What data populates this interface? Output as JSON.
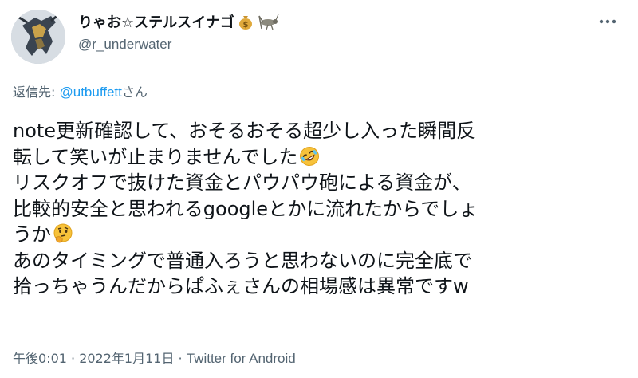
{
  "author": {
    "display_name": "りゃお☆ステルスイナゴ",
    "name_icons": [
      "money-bag-icon",
      "grasshopper-icon"
    ],
    "handle": "@r_underwater"
  },
  "reply": {
    "prefix": "返信先: ",
    "mention": "@utbuffett",
    "suffix": "さん"
  },
  "tweet": {
    "lines": [
      "note更新確認して、おそるおそる超少し入った瞬間反",
      "転して笑いが止まりませんでした",
      "リスクオフで抜けた資金とパウパウ砲による資金が、",
      "比較的安全と思われるgoogleとかに流れたからでしょ",
      "うか",
      "あのタイミングで普通入ろうと思わないのに完全底で",
      "拾っちゃうんだからぱふぇさんの相場感は異常ですw"
    ],
    "emojis": [
      "rolling-laughing-emoji",
      "thinking-face-emoji"
    ]
  },
  "meta": {
    "time_date": "午後0:01 · 2022年1月11日 · ",
    "source": "Twitter for Android"
  },
  "colors": {
    "text": "#0f1419",
    "secondary": "#536471",
    "link": "#1d9bf0"
  }
}
